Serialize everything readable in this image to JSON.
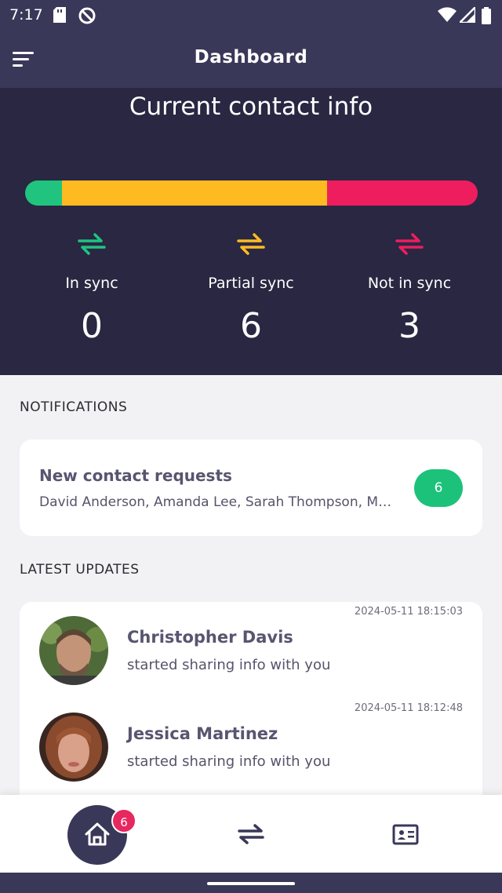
{
  "status_bar": {
    "time": "7:17"
  },
  "app_bar": {
    "title": "Dashboard"
  },
  "hero": {
    "title": "Current contact info",
    "bar_colors": {
      "in_sync": "#20c47f",
      "partial_sync": "#fdbb21",
      "not_in_sync": "#ee1d5e"
    },
    "stats": [
      {
        "label": "In sync",
        "count": "0",
        "color": "#20c47f",
        "icon": "sync-arrows-icon"
      },
      {
        "label": "Partial sync",
        "count": "6",
        "color": "#fdbb21",
        "icon": "sync-arrows-icon"
      },
      {
        "label": "Not in sync",
        "count": "3",
        "color": "#ee1d5e",
        "icon": "sync-arrows-icon"
      }
    ]
  },
  "notifications": {
    "heading": "NOTIFICATIONS",
    "card": {
      "title": "New contact requests",
      "names": "David Anderson, Amanda Lee, Sarah Thompson, Ma...",
      "count": "6"
    }
  },
  "latest_updates": {
    "heading": "LATEST UPDATES",
    "items": [
      {
        "name": "Christopher Davis",
        "text": "started sharing info with you",
        "time": "2024-05-11 18:15:03"
      },
      {
        "name": "Jessica Martinez",
        "text": "started sharing info with you",
        "time": "2024-05-11 18:12:48"
      }
    ]
  },
  "bottom_nav": {
    "home_badge": "6",
    "items": [
      {
        "icon": "home-icon"
      },
      {
        "icon": "sync-arrows-icon"
      },
      {
        "icon": "contact-card-icon"
      }
    ]
  },
  "colors": {
    "primary": "#3a3858",
    "hero_bg": "#292742",
    "success": "#1cc27a",
    "badge": "#e8265f"
  }
}
